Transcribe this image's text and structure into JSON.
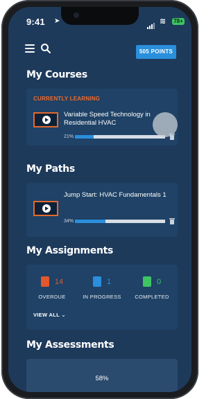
{
  "status": {
    "time": "9:41",
    "battery": "78+"
  },
  "topbar": {
    "points_label": "505 POINTS"
  },
  "sections": {
    "courses": "My Courses",
    "paths": "My Paths",
    "assignments": "My Assignments",
    "assessments": "My Assessments"
  },
  "course": {
    "label": "CURRENTLY LEARNING",
    "title": "Variable Speed Technology in Residential HVAC",
    "progress_text": "21%",
    "progress": 0.21
  },
  "path": {
    "title": "Jump Start: HVAC Fundamentals 1",
    "progress_text": "34%",
    "progress": 0.34
  },
  "assignments": {
    "overdue": {
      "count": "14",
      "label": "OVERDUE",
      "color": "#e2572b"
    },
    "in_progress": {
      "count": "1",
      "label": "IN PROGRESS",
      "color": "#2a8fdc"
    },
    "completed": {
      "count": "0",
      "label": "COMPLETED",
      "color": "#3ec463"
    },
    "view_all": "VIEW ALL"
  },
  "assessments": {
    "progress_text": "58%"
  },
  "colors": {
    "background": "#1e3a5b",
    "card": "#1f4266",
    "accent": "#2a8fdc",
    "orange": "#e46a2d"
  }
}
